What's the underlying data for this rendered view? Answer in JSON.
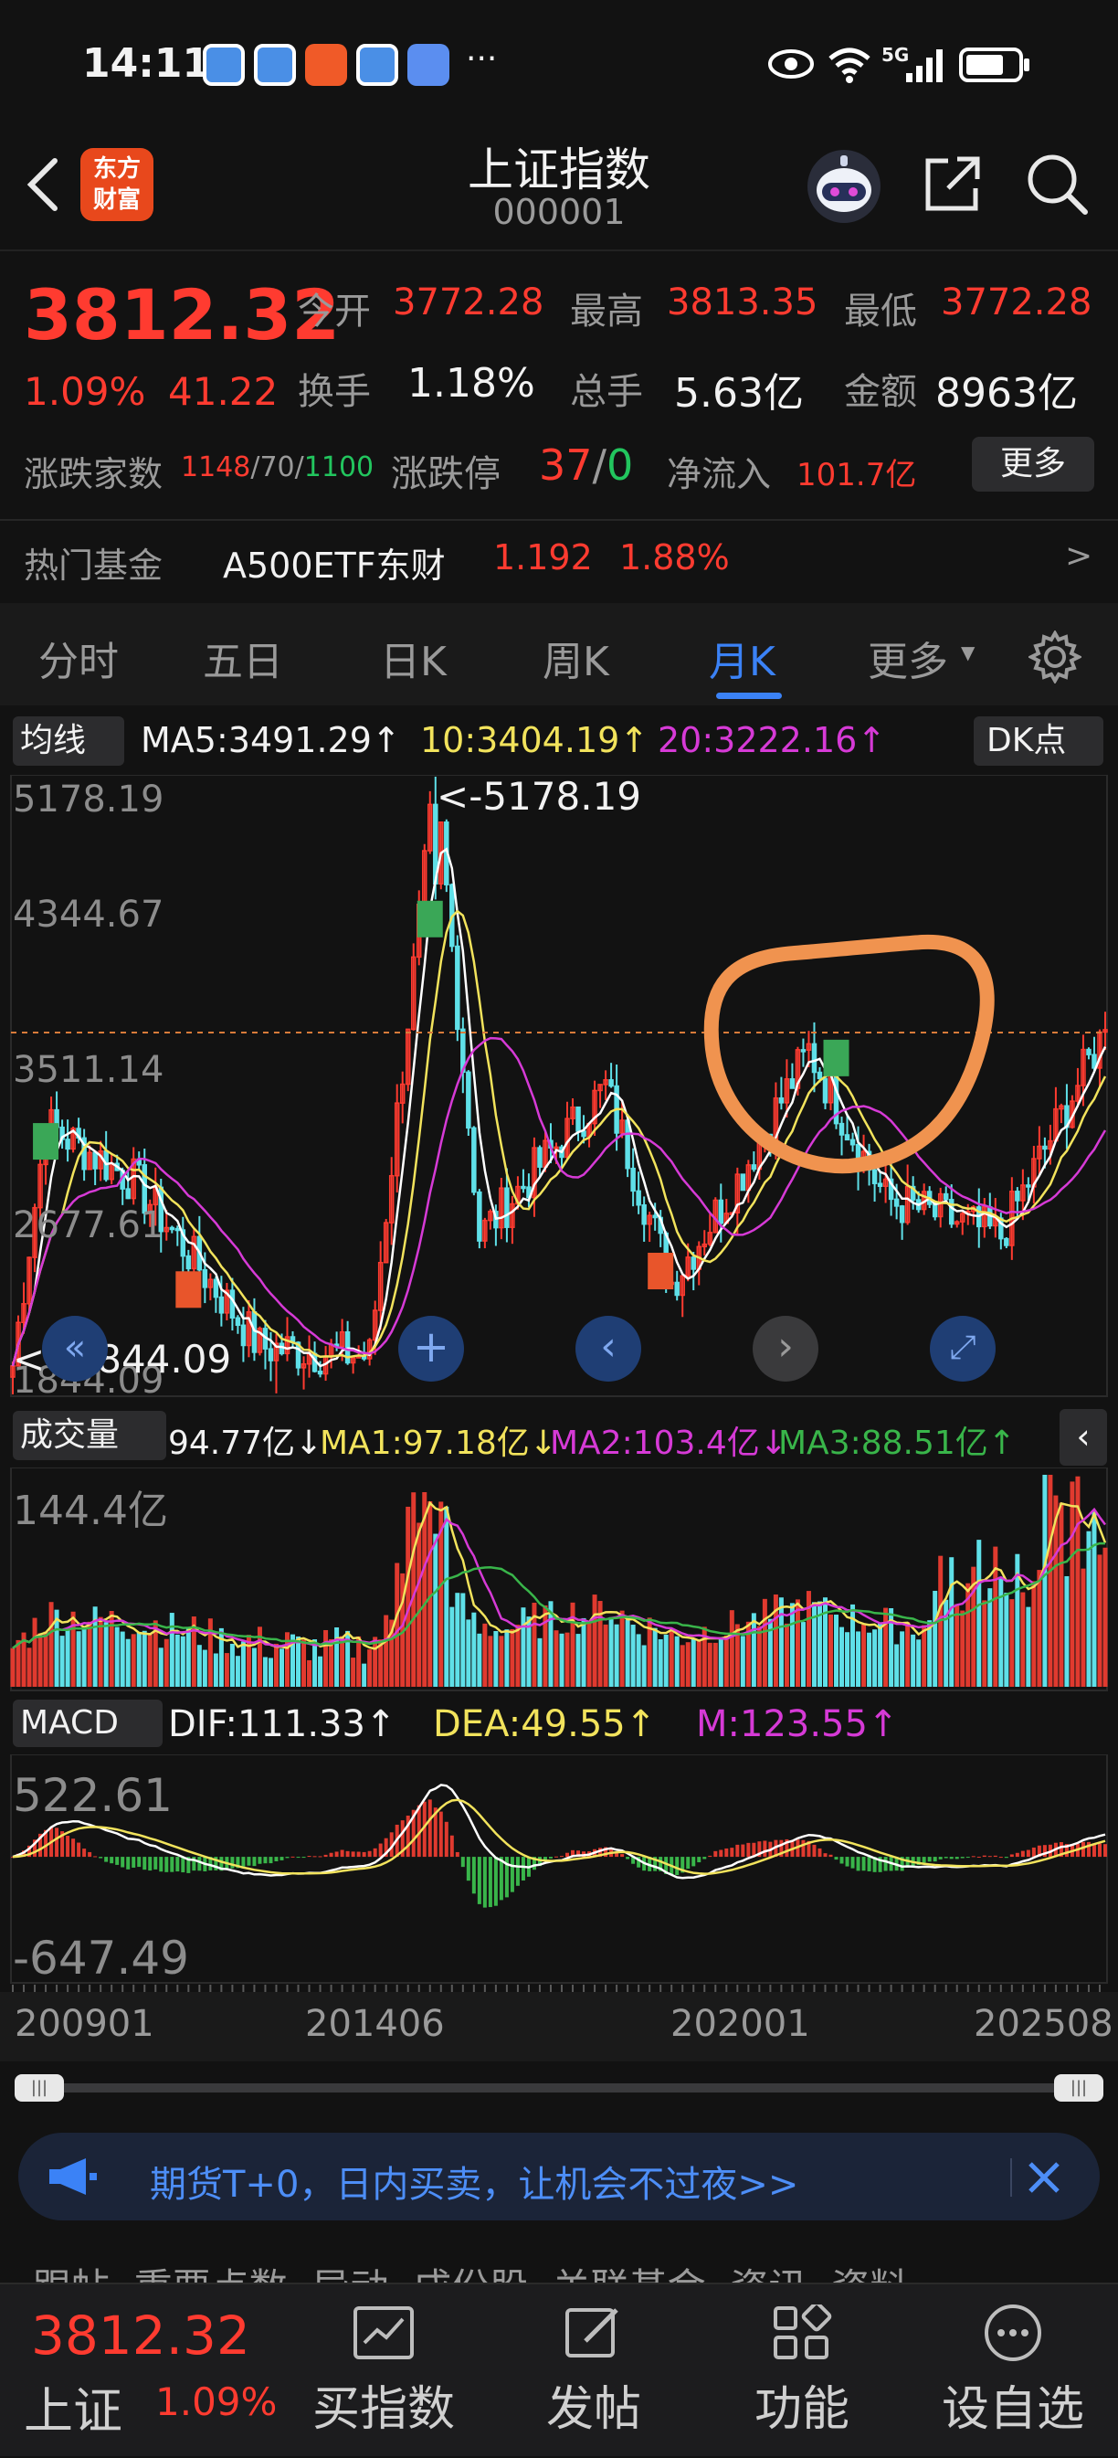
{
  "status_bar": {
    "time": "14:11",
    "network": "5G",
    "more": "···"
  },
  "header": {
    "logo_line1": "东方",
    "logo_line2": "财富",
    "title": "上证指数",
    "code": "000001"
  },
  "quote": {
    "price": "3812.32",
    "change_pct": "1.09%",
    "change": "41.22",
    "open_label": "今开",
    "open": "3772.28",
    "high_label": "最高",
    "high": "3813.35",
    "low_label": "最低",
    "low": "3772.28",
    "turnover_label": "换手",
    "turnover": "1.18%",
    "volume_label": "总手",
    "volume": "5.63亿",
    "amount_label": "金额",
    "amount": "8963亿",
    "breadth_label": "涨跌家数",
    "breadth_up": "1148",
    "breadth_flat": "70",
    "breadth_down": "1100",
    "limit_label": "涨跌停",
    "limit_up": "37",
    "limit_down": "0",
    "inflow_label": "净流入",
    "inflow": "101.7亿",
    "more_button": "更多"
  },
  "fund": {
    "label": "热门基金",
    "name": "A500ETF东财",
    "price": "1.192",
    "pct": "1.88%",
    "arrow": ">"
  },
  "tabs": [
    {
      "label": "分时"
    },
    {
      "label": "五日"
    },
    {
      "label": "日K"
    },
    {
      "label": "周K"
    },
    {
      "label": "月K"
    },
    {
      "label": "更多"
    }
  ],
  "tabs_active": "月K",
  "ma_bar": {
    "selector": "均线",
    "ma5": "MA5:3491.29↑",
    "ma10": "10:3404.19↑",
    "ma20": "20:3222.16↑",
    "dk": "DK点"
  },
  "kline": {
    "y_top": "5178.19",
    "y_2": "4344.67",
    "y_3": "3511.14",
    "y_4": "2677.61",
    "y_bottom": "1844.09",
    "max_label": "<-5178.19",
    "min_label": "<--1844.09"
  },
  "vol_bar": {
    "selector": "成交量",
    "value": "94.77亿↓",
    "ma1": "MA1:97.18亿↓",
    "ma2": "MA2:103.4亿↓",
    "ma3": "MA3:88.51亿↑"
  },
  "vol_chart": {
    "y_top": "144.4亿"
  },
  "macd_bar": {
    "selector": "MACD",
    "dif": "DIF:111.33↑",
    "dea": "DEA:49.55↑",
    "m": "M:123.55↑"
  },
  "macd_chart": {
    "y_top": "522.61",
    "y_bottom": "-647.49"
  },
  "x_axis": {
    "d1": "200901",
    "d2": "201406",
    "d3": "202001",
    "d4": "202508"
  },
  "ad": {
    "text": "期货T+0，日内买卖，让机会不过夜>>"
  },
  "bottom_tabs_partial": "跟帖  重要点数  异动  成份股  关联基金  资讯  资料",
  "bottom_nav": {
    "index_price": "3812.32",
    "index_name": "上证",
    "index_pct": "1.09%",
    "buy_index": "买指数",
    "post": "发帖",
    "functions": "功能",
    "add_watch": "设自选"
  },
  "colors": {
    "up": "#ff3b30",
    "down": "#22c55e",
    "accent": "#3b82f6",
    "ma5": "#ffffff",
    "ma10": "#f2e35c",
    "ma20": "#d63ad6",
    "annotation": "#f0934f"
  },
  "chart_data": [
    {
      "type": "candlestick",
      "title": "上证指数 月K",
      "x": [
        "200901",
        "201406",
        "202001",
        "202508"
      ],
      "ylim": [
        1844.09,
        5178.19
      ],
      "max": 5178.19,
      "min": 1844.09,
      "close_approx": [
        {
          "x": "200901",
          "y": 2000
        },
        {
          "x": "200907",
          "y": 3300
        },
        {
          "x": "201011",
          "y": 3000
        },
        {
          "x": "201210",
          "y": 2100
        },
        {
          "x": "201406",
          "y": 2050
        },
        {
          "x": "201506",
          "y": 5178.19
        },
        {
          "x": "201602",
          "y": 2700
        },
        {
          "x": "201801",
          "y": 3500
        },
        {
          "x": "201901",
          "y": 2450
        },
        {
          "x": "202001",
          "y": 3000
        },
        {
          "x": "202102",
          "y": 3700
        },
        {
          "x": "202204",
          "y": 2900
        },
        {
          "x": "202401",
          "y": 2700
        },
        {
          "x": "202508",
          "y": 3812.32
        }
      ],
      "series": [
        {
          "name": "MA5",
          "value": 3491.29
        },
        {
          "name": "MA10",
          "value": 3404.19
        },
        {
          "name": "MA20",
          "value": 3222.16
        }
      ]
    },
    {
      "type": "bar",
      "title": "成交量",
      "ylim": [
        0,
        144.4
      ],
      "series": [
        {
          "name": "成交量",
          "value": 94.77
        },
        {
          "name": "MA1",
          "value": 97.18
        },
        {
          "name": "MA2",
          "value": 103.4
        },
        {
          "name": "MA3",
          "value": 88.51
        }
      ]
    },
    {
      "type": "line",
      "title": "MACD",
      "ylim": [
        -647.49,
        522.61
      ],
      "series": [
        {
          "name": "DIF",
          "value": 111.33
        },
        {
          "name": "DEA",
          "value": 49.55
        },
        {
          "name": "M",
          "value": 123.55
        }
      ]
    }
  ]
}
